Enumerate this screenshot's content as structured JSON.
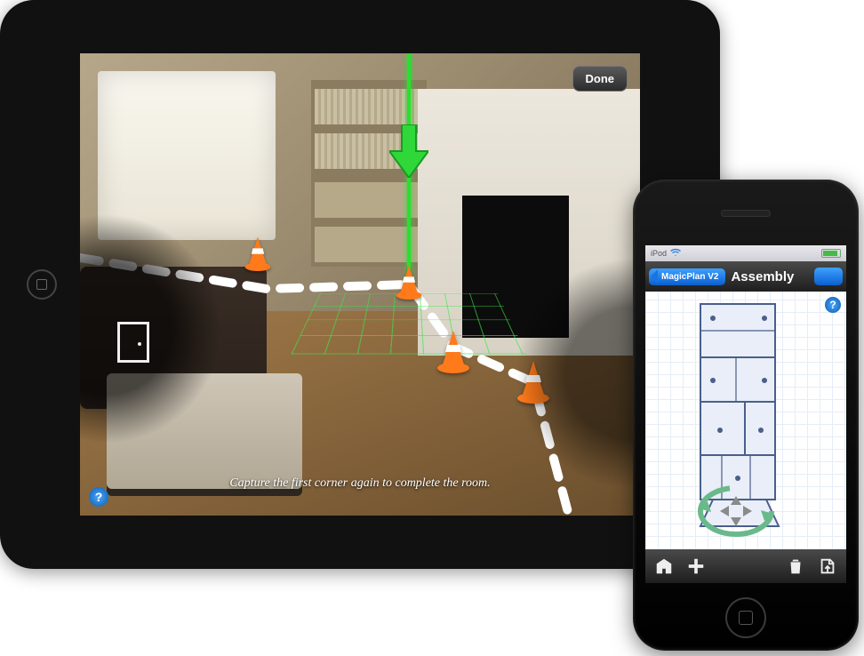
{
  "ipad": {
    "done_label": "Done",
    "instruction": "Capture the first corner again to complete the room.",
    "help_glyph": "?",
    "door_icon_name": "door-icon"
  },
  "iphone": {
    "status": {
      "device": "iPod"
    },
    "nav": {
      "back_label": "MagicPlan V2",
      "title": "Assembly",
      "right_label": ""
    },
    "help_glyph": "?"
  }
}
